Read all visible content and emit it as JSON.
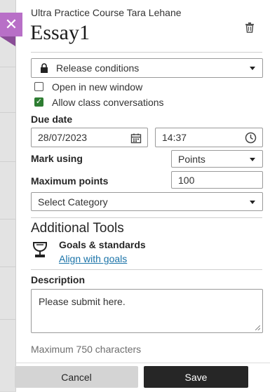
{
  "close": {
    "glyph": "✕"
  },
  "header": {
    "course": "Ultra Practice Course Tara Lehane",
    "title": "Essay1"
  },
  "release": {
    "label": "Release conditions"
  },
  "options": {
    "open_new_window": {
      "label": "Open in new window",
      "checked": false
    },
    "class_conversations": {
      "label": "Allow class conversations",
      "checked": true
    }
  },
  "due": {
    "label": "Due date",
    "date": "28/07/2023",
    "time": "14:37"
  },
  "mark": {
    "label": "Mark using",
    "value": "Points"
  },
  "max_points": {
    "label": "Maximum points",
    "value": "100"
  },
  "category": {
    "value": "Select Category"
  },
  "tools": {
    "title": "Additional Tools",
    "goals_title": "Goals & standards",
    "goals_link": "Align with goals"
  },
  "description": {
    "label": "Description",
    "value": "Please submit here.",
    "limit": "Maximum 750 characters"
  },
  "actions": {
    "cancel": "Cancel",
    "save": "Save"
  },
  "colors": {
    "accent_close": "#b86fc7",
    "check_green": "#2e7d32",
    "link_blue": "#1a73a8",
    "save_bg": "#262626"
  }
}
